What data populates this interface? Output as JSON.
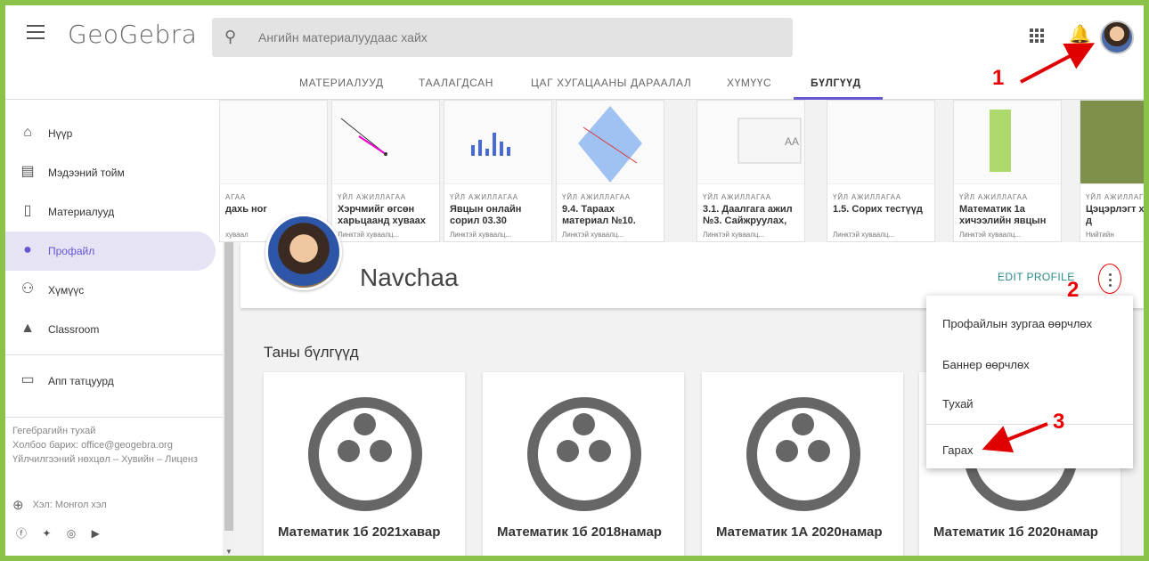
{
  "app": {
    "logo": "GeoGebra",
    "search_placeholder": "Ангийн материалуудаас хайх"
  },
  "tabs": [
    "МАТЕРИАЛУУД",
    "ТААЛАГДСАН",
    "ЦАГ ХУГАЦААНЫ ДАРААЛАЛ",
    "ХҮМҮҮС",
    "БҮЛГҮҮД"
  ],
  "active_tab": "БҮЛГҮҮД",
  "sidebar": {
    "items": [
      {
        "label": "Нүүр",
        "icon": "home-icon"
      },
      {
        "label": "Мэдээний тойм",
        "icon": "newsfeed-icon"
      },
      {
        "label": "Материалууд",
        "icon": "document-icon"
      },
      {
        "label": "Профайл",
        "icon": "person-icon"
      },
      {
        "label": "Хүмүүс",
        "icon": "people-icon"
      },
      {
        "label": "Classroom",
        "icon": "classroom-icon"
      },
      {
        "label": "Апп татцуурд",
        "icon": "devices-icon"
      }
    ],
    "active": "Профайл",
    "footer": [
      "Гегебрагийн тухай",
      "Холбоо барих: office@geogebra.org",
      "Үйлчилгээний нөхцөл – Хувийн – Лиценз"
    ],
    "language": "Хэл: Монгол хэл"
  },
  "materials": [
    {
      "type": "АГАА",
      "title": "дахь ноr",
      "visibility": "хуваал"
    },
    {
      "type": "ҮЙЛ АЖИЛЛАГАА",
      "title": "Хэрчмийг өгсөн харьцаанд хуваах",
      "visibility": "Линктэй хуваалц..."
    },
    {
      "type": "ҮЙЛ АЖИЛЛАГАА",
      "title": "Явцын онлайн сорил 03.30",
      "visibility": "Линктэй хуваалц..."
    },
    {
      "type": "ҮЙЛ АЖИЛЛАГАА",
      "title": "9.4. Тараах материал №10.",
      "visibility": "Линктэй хуваалц..."
    },
    {
      "type": "ҮЙЛ АЖИЛЛАГАА",
      "title": "3.1. Даалгага ажил №3. Сайжруулах,",
      "visibility": "Линктэй хуваалц..."
    },
    {
      "type": "ҮЙЛ АЖИЛЛАГАА",
      "title": "1.5. Сорих тестүүд",
      "visibility": "Линктэй хуваалц..."
    },
    {
      "type": "ҮЙЛ АЖИЛЛАГАА",
      "title": "Математик 1а хичээлийн явцын",
      "visibility": "Линктэй хуваалц..."
    },
    {
      "type": "ҮЙЛ АЖИЛЛАГ",
      "title": "Цэцэрлэгт хүрээлэн д",
      "visibility": "Нийтийн"
    }
  ],
  "profile": {
    "name": "Navchaa",
    "edit_label": "EDIT PROFILE"
  },
  "menu": {
    "items": [
      "Профайлын зургаа өөрчлөх",
      "Баннер өөрчлөх",
      "Тухай",
      "Гарах"
    ]
  },
  "groups": {
    "title": "Таны бүлгүүд",
    "items": [
      {
        "title": "Математик 1б 2021хавар"
      },
      {
        "title": "Математик 1б 2018намар"
      },
      {
        "title": "Математик 1А 2020намар"
      },
      {
        "title": "Математик 1б 2020намар"
      }
    ]
  },
  "annotations": [
    "1",
    "2",
    "3"
  ],
  "annotation_color": "#e00000",
  "accent_color": "#6557d2",
  "frame_color": "#8bc34a"
}
